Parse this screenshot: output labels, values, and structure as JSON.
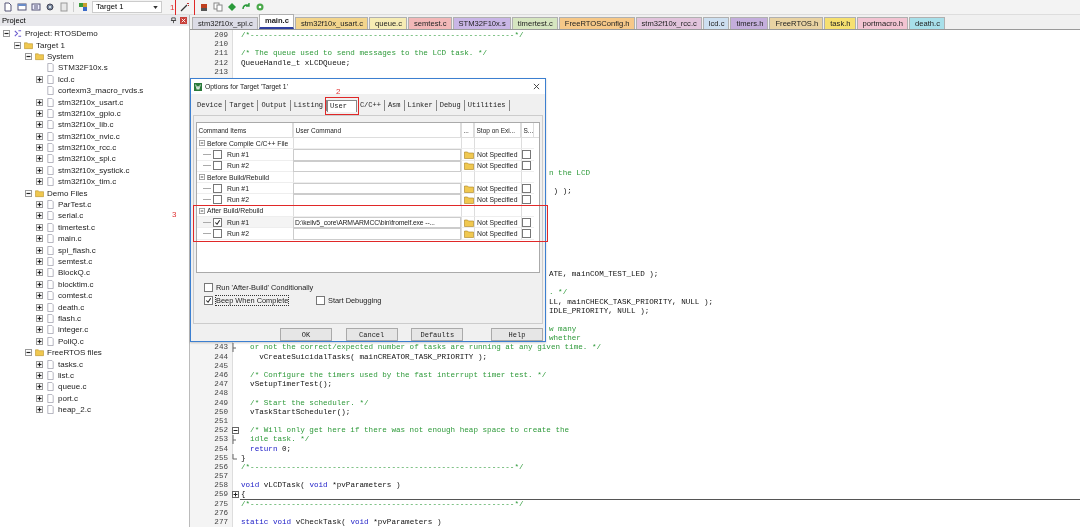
{
  "toolbar": {
    "target": "Target 1",
    "annotation": "1"
  },
  "project": {
    "title": "Project",
    "tree": [
      {
        "label": "Project: RTOSDemo",
        "kind": "project",
        "expanded": true,
        "children": [
          {
            "label": "Target 1",
            "kind": "target",
            "expanded": true,
            "children": [
              {
                "label": "System",
                "kind": "folder",
                "expanded": true,
                "children": [
                  {
                    "label": "STM32F10x.s",
                    "kind": "file",
                    "expandable": false
                  },
                  {
                    "label": "lcd.c",
                    "kind": "file",
                    "expandable": true
                  },
                  {
                    "label": "cortexm3_macro_rvds.s",
                    "kind": "file",
                    "expandable": false
                  },
                  {
                    "label": "stm32f10x_usart.c",
                    "kind": "file",
                    "expandable": true
                  },
                  {
                    "label": "stm32f10x_gpio.c",
                    "kind": "file",
                    "expandable": true
                  },
                  {
                    "label": "stm32f10x_lib.c",
                    "kind": "file",
                    "expandable": true
                  },
                  {
                    "label": "stm32f10x_nvic.c",
                    "kind": "file",
                    "expandable": true
                  },
                  {
                    "label": "stm32f10x_rcc.c",
                    "kind": "file",
                    "expandable": true
                  },
                  {
                    "label": "stm32f10x_spi.c",
                    "kind": "file",
                    "expandable": true
                  },
                  {
                    "label": "stm32f10x_systick.c",
                    "kind": "file",
                    "expandable": true
                  },
                  {
                    "label": "stm32f10x_tim.c",
                    "kind": "file",
                    "expandable": true
                  }
                ]
              },
              {
                "label": "Demo Files",
                "kind": "folder",
                "expanded": true,
                "children": [
                  {
                    "label": "ParTest.c",
                    "kind": "file",
                    "expandable": true
                  },
                  {
                    "label": "serial.c",
                    "kind": "file",
                    "expandable": true
                  },
                  {
                    "label": "timertest.c",
                    "kind": "file",
                    "expandable": true
                  },
                  {
                    "label": "main.c",
                    "kind": "file",
                    "expandable": true
                  },
                  {
                    "label": "spi_flash.c",
                    "kind": "file",
                    "expandable": true
                  },
                  {
                    "label": "semtest.c",
                    "kind": "file",
                    "expandable": true
                  },
                  {
                    "label": "BlockQ.c",
                    "kind": "file",
                    "expandable": true
                  },
                  {
                    "label": "blocktim.c",
                    "kind": "file",
                    "expandable": true
                  },
                  {
                    "label": "comtest.c",
                    "kind": "file",
                    "expandable": true
                  },
                  {
                    "label": "death.c",
                    "kind": "file",
                    "expandable": true
                  },
                  {
                    "label": "flash.c",
                    "kind": "file",
                    "expandable": true
                  },
                  {
                    "label": "integer.c",
                    "kind": "file",
                    "expandable": true
                  },
                  {
                    "label": "PollQ.c",
                    "kind": "file",
                    "expandable": true
                  }
                ]
              },
              {
                "label": "FreeRTOS files",
                "kind": "folder",
                "expanded": true,
                "children": [
                  {
                    "label": "tasks.c",
                    "kind": "file",
                    "expandable": true
                  },
                  {
                    "label": "list.c",
                    "kind": "file",
                    "expandable": true
                  },
                  {
                    "label": "queue.c",
                    "kind": "file",
                    "expandable": true
                  },
                  {
                    "label": "port.c",
                    "kind": "file",
                    "expandable": true
                  },
                  {
                    "label": "heap_2.c",
                    "kind": "file",
                    "expandable": true
                  }
                ]
              }
            ]
          }
        ]
      }
    ]
  },
  "file_tabs": [
    {
      "label": "stm32f10x_spi.c",
      "selected": false,
      "color": "#dcdce6"
    },
    {
      "label": "main.c",
      "selected": true,
      "color": "#ffffff"
    },
    {
      "label": "stm32f10x_usart.c",
      "selected": false,
      "color": "#f3d58c"
    },
    {
      "label": "queue.c",
      "selected": false,
      "color": "#f6ecb4"
    },
    {
      "label": "semtest.c",
      "selected": false,
      "color": "#f2b8b8"
    },
    {
      "label": "STM32F10x.s",
      "selected": false,
      "color": "#c9b6e6"
    },
    {
      "label": "timertest.c",
      "selected": false,
      "color": "#d6e6c0"
    },
    {
      "label": "FreeRTOSConfig.h",
      "selected": false,
      "color": "#f6c888"
    },
    {
      "label": "stm32f10x_rcc.c",
      "selected": false,
      "color": "#e2c4dc"
    },
    {
      "label": "lcd.c",
      "selected": false,
      "color": "#cddff0"
    },
    {
      "label": "timers.h",
      "selected": false,
      "color": "#c4aedc"
    },
    {
      "label": "FreeRTOS.h",
      "selected": false,
      "color": "#e9d3a3"
    },
    {
      "label": "task.h",
      "selected": false,
      "color": "#f6e070"
    },
    {
      "label": "portmacro.h",
      "selected": false,
      "color": "#f2c4d2"
    },
    {
      "label": "death.c",
      "selected": false,
      "color": "#a8e0ea"
    }
  ],
  "code": [
    {
      "kind": "line",
      "number": "209",
      "parts": [
        {
          "kind": "comment",
          "text": "/*----------------------------------------------------------*/"
        }
      ]
    },
    {
      "kind": "line",
      "number": "210"
    },
    {
      "kind": "line",
      "number": "211",
      "parts": [
        {
          "kind": "comment",
          "text": "/* The queue used to send messages to the LCD task. */"
        }
      ]
    },
    {
      "kind": "line",
      "number": "212",
      "parts": [
        {
          "kind": "plain",
          "text": "QueueHandle_t xLCDQueue;"
        }
      ]
    },
    {
      "kind": "line",
      "number": "213"
    },
    {
      "kind": "hidden"
    },
    {
      "kind": "hidden"
    },
    {
      "kind": "hidden"
    },
    {
      "kind": "hidden"
    },
    {
      "kind": "hidden"
    },
    {
      "kind": "hidden"
    },
    {
      "kind": "hidden"
    },
    {
      "kind": "hidden"
    },
    {
      "kind": "hidden"
    },
    {
      "kind": "hidden"
    },
    {
      "kind": "covered",
      "parts": [
        {
          "kind": "comment",
          "text": "n the LCD"
        }
      ]
    },
    {
      "kind": "hidden"
    },
    {
      "kind": "covered",
      "parts": [
        {
          "kind": "plain",
          "text": " ) );"
        }
      ]
    },
    {
      "kind": "hidden"
    },
    {
      "kind": "hidden"
    },
    {
      "kind": "hidden"
    },
    {
      "kind": "hidden"
    },
    {
      "kind": "hidden"
    },
    {
      "kind": "hidden"
    },
    {
      "kind": "hidden"
    },
    {
      "kind": "hidden"
    },
    {
      "kind": "covered",
      "parts": [
        {
          "kind": "plain",
          "text": "ATE, mainCOM_TEST_LED );"
        }
      ]
    },
    {
      "kind": "hidden"
    },
    {
      "kind": "covered",
      "parts": [
        {
          "kind": "comment",
          "text": ". */"
        }
      ]
    },
    {
      "kind": "covered",
      "parts": [
        {
          "kind": "plain",
          "text": "LL, mainCHECK_TASK_PRIORITY, NULL );"
        }
      ]
    },
    {
      "kind": "covered",
      "parts": [
        {
          "kind": "plain",
          "text": "IDLE_PRIORITY, NULL );"
        }
      ]
    },
    {
      "kind": "hidden"
    },
    {
      "kind": "covered",
      "parts": [
        {
          "kind": "comment",
          "text": "w many"
        }
      ]
    },
    {
      "kind": "covered",
      "parts": [
        {
          "kind": "comment",
          "text": "whether"
        }
      ]
    },
    {
      "kind": "foldinner",
      "number": "243",
      "parts": [
        {
          "kind": "comment",
          "text": "  or not the correct/expected number of tasks are running at any given time. */"
        }
      ]
    },
    {
      "kind": "line",
      "number": "244",
      "parts": [
        {
          "kind": "plain",
          "text": "    vCreateSuicidalTasks( mainCREATOR_TASK_PRIORITY );"
        }
      ]
    },
    {
      "kind": "line",
      "number": "245"
    },
    {
      "kind": "line",
      "number": "246",
      "parts": [
        {
          "kind": "comment",
          "text": "  /* Configure the timers used by the fast interrupt timer test. */"
        }
      ]
    },
    {
      "kind": "line",
      "number": "247",
      "parts": [
        {
          "kind": "plain",
          "text": "  vSetupTimerTest();"
        }
      ]
    },
    {
      "kind": "line",
      "number": "248"
    },
    {
      "kind": "line",
      "number": "249",
      "parts": [
        {
          "kind": "comment",
          "text": "  /* Start the scheduler. */"
        }
      ]
    },
    {
      "kind": "line",
      "number": "250",
      "parts": [
        {
          "kind": "plain",
          "text": "  vTaskStartScheduler();"
        }
      ]
    },
    {
      "kind": "line",
      "number": "251"
    },
    {
      "kind": "foldopen",
      "number": "252",
      "parts": [
        {
          "kind": "comment",
          "text": "  /* Will only get here if there was not enough heap space to create the"
        }
      ]
    },
    {
      "kind": "foldinner",
      "number": "253",
      "parts": [
        {
          "kind": "comment",
          "text": "  idle task. */"
        }
      ]
    },
    {
      "kind": "line",
      "number": "254",
      "parts": [
        {
          "kind": "keyword",
          "text": "  return"
        },
        {
          "kind": "plain",
          "text": " 0;"
        }
      ]
    },
    {
      "kind": "foldend",
      "number": "255",
      "parts": [
        {
          "kind": "plain",
          "text": "}"
        }
      ]
    },
    {
      "kind": "line",
      "number": "256",
      "parts": [
        {
          "kind": "comment",
          "text": "/*----------------------------------------------------------*/"
        }
      ]
    },
    {
      "kind": "line",
      "number": "257"
    },
    {
      "kind": "line",
      "number": "258",
      "parts": [
        {
          "kind": "keyword",
          "text": "void"
        },
        {
          "kind": "plain",
          "text": " vLCDTask( "
        },
        {
          "kind": "keyword",
          "text": "void"
        },
        {
          "kind": "plain",
          "text": " *pvParameters )"
        }
      ]
    },
    {
      "kind": "foldclosed",
      "number": "259",
      "parts": [
        {
          "kind": "plain",
          "text": "{"
        }
      ]
    },
    {
      "kind": "line",
      "number": "275",
      "parts": [
        {
          "kind": "comment",
          "text": "/*----------------------------------------------------------*/"
        }
      ]
    },
    {
      "kind": "line",
      "number": "276"
    },
    {
      "kind": "line",
      "number": "277",
      "parts": [
        {
          "kind": "keyword",
          "text": "static void"
        },
        {
          "kind": "plain",
          "text": " vCheckTask( "
        },
        {
          "kind": "keyword",
          "text": "void"
        },
        {
          "kind": "plain",
          "text": " *pvParameters )"
        }
      ]
    }
  ],
  "dialog": {
    "title": "Options for Target 'Target 1'",
    "tabs": [
      {
        "label": "Device",
        "selected": false
      },
      {
        "label": "Target",
        "selected": false
      },
      {
        "label": "Output",
        "selected": false
      },
      {
        "label": "Listing",
        "selected": false
      },
      {
        "label": "User",
        "selected": true,
        "annotation": "2"
      },
      {
        "label": "C/C++",
        "selected": false
      },
      {
        "label": "Asm",
        "selected": false
      },
      {
        "label": "Linker",
        "selected": false
      },
      {
        "label": "Debug",
        "selected": false
      },
      {
        "label": "Utilities",
        "selected": false
      }
    ],
    "columns": [
      "Command Items",
      "User Command",
      "...",
      "Stop on Exi...",
      "S..."
    ],
    "groups": [
      {
        "label": "Before Compile C/C++ File",
        "expanded": true,
        "runs": [
          {
            "label": "Run #1",
            "checked": false,
            "stop": "Not Specified",
            "stop_checked": false
          },
          {
            "label": "Run #2",
            "checked": false,
            "stop": "Not Specified",
            "stop_checked": false
          }
        ]
      },
      {
        "label": "Before Build/Rebuild",
        "expanded": true,
        "runs": [
          {
            "label": "Run #1",
            "checked": false,
            "stop": "Not Specified",
            "stop_checked": false
          },
          {
            "label": "Run #2",
            "checked": false,
            "stop": "Not Specified",
            "stop_checked": false
          }
        ]
      },
      {
        "label": "After Build/Rebuild",
        "expanded": true,
        "annotation": "3",
        "runs": [
          {
            "label": "Run #1",
            "checked": true,
            "command": "D:\\keilv5_core\\ARM\\ARMCC\\bin\\fromelf.exe  --...",
            "stop": "Not Specified",
            "stop_checked": false
          },
          {
            "label": "Run #2",
            "checked": false,
            "stop": "Not Specified",
            "stop_checked": false
          }
        ]
      }
    ],
    "options": [
      {
        "label": "Run 'After-Build' Conditionally",
        "checked": false
      },
      {
        "label": "Beep When Complete",
        "checked": true
      },
      {
        "label": "Start Debugging",
        "checked": false
      }
    ],
    "buttons": [
      "OK",
      "Cancel",
      "Defaults",
      "Help"
    ]
  }
}
